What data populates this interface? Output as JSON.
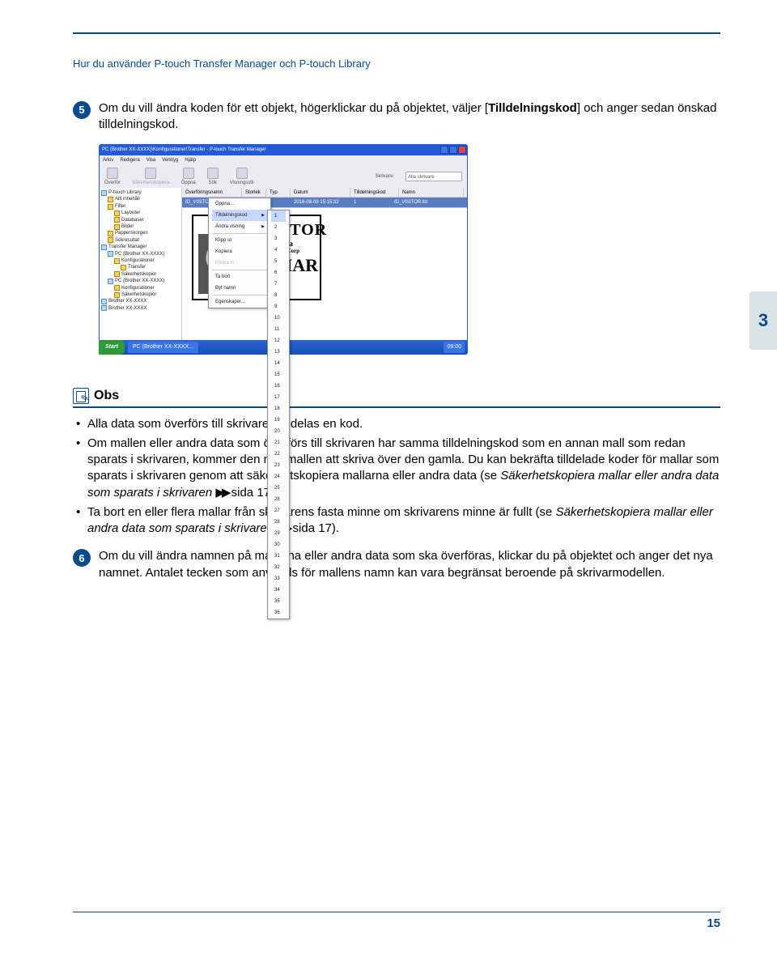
{
  "header": {
    "title": "Hur du använder P-touch Transfer Manager och P-touch Library"
  },
  "sideChapter": "3",
  "step5": {
    "num": "5",
    "text_a": "Om du vill ändra koden för ett objekt, högerklickar du på objektet, väljer [",
    "text_key": "Tilldelningskod",
    "text_b": "] och anger sedan önskad tilldelningskod."
  },
  "screenshot": {
    "title": "PC (Brother XX-XXXX)\\Konfigurationer\\Transfer - P-touch Transfer Manager",
    "menu": [
      "Arkiv",
      "Redigera",
      "Visa",
      "Verktyg",
      "Hjälp"
    ],
    "toolbar": [
      {
        "label": "Överför",
        "grey": false
      },
      {
        "label": "Säkerhetskopiera",
        "grey": true
      },
      {
        "label": "Öppna",
        "grey": false
      },
      {
        "label": "Sök",
        "grey": false
      },
      {
        "label": "Visningsstil",
        "grey": false
      }
    ],
    "printerLabel": "Skrivare:",
    "printerValue": "Alla skrivare",
    "tree": [
      {
        "label": "P-touch Library",
        "icon": "p"
      },
      {
        "label": "Allt innehåll",
        "icon": "i",
        "ind": 1
      },
      {
        "label": "Filter",
        "icon": "i",
        "ind": 1
      },
      {
        "label": "Layouter",
        "icon": "i",
        "ind": 2
      },
      {
        "label": "Databaser",
        "icon": "i",
        "ind": 2
      },
      {
        "label": "Bilder",
        "icon": "i",
        "ind": 2
      },
      {
        "label": "Papperskorgen",
        "icon": "i",
        "ind": 1
      },
      {
        "label": "Sökresultat",
        "icon": "i",
        "ind": 1
      },
      {
        "label": "Transfer Manager",
        "icon": "p"
      },
      {
        "label": "PC (Brother XX-XXXX)",
        "icon": "p",
        "ind": 1
      },
      {
        "label": "Konfigurationer",
        "icon": "i",
        "ind": 2
      },
      {
        "label": "Transfer",
        "icon": "i",
        "ind": 3
      },
      {
        "label": "Säkerhetskopior",
        "icon": "i",
        "ind": 2
      },
      {
        "label": "PC (Brother XX-XXXX)",
        "icon": "p",
        "ind": 1
      },
      {
        "label": "Konfigurationer",
        "icon": "i",
        "ind": 2
      },
      {
        "label": "Säkerhetskopior",
        "icon": "i",
        "ind": 2
      },
      {
        "label": "Brother XX-XXXX",
        "icon": "p"
      },
      {
        "label": "Brother XX-XXXX",
        "icon": "p"
      }
    ],
    "columns": [
      "Överföringsnamn",
      "Storlek",
      "Typ",
      "Datum",
      "Tilldelningskod",
      "Namn"
    ],
    "row": {
      "name": "ID_VISITOR",
      "size": "",
      "type": "",
      "date": "2016-08-09 15:15:32",
      "code": "1",
      "file": "ID_VISITOR.lbl"
    },
    "context": {
      "items": [
        {
          "label": "Öppna...",
          "grey": false
        },
        {
          "label": "Tilldelningskod",
          "grey": false,
          "sel": true,
          "sub": true
        },
        {
          "label": "Ändra visning",
          "grey": false,
          "sub": true
        },
        {
          "label": "hr"
        },
        {
          "label": "Klipp ut",
          "grey": false
        },
        {
          "label": "Kopiera",
          "grey": false
        },
        {
          "label": "Klistra in",
          "grey": true
        },
        {
          "label": "hr"
        },
        {
          "label": "Ta bort",
          "grey": false
        },
        {
          "label": "Byt namn",
          "grey": false
        },
        {
          "label": "hr"
        },
        {
          "label": "Egenskaper...",
          "grey": false
        }
      ],
      "subCount": 36,
      "subSelected": "1"
    },
    "preview": {
      "visitor": "VISITOR",
      "name": "Mr. Yoshima",
      "corp": "International Corp",
      "date": "13 MAR\n05"
    },
    "taskbar": {
      "start": "Start",
      "task": "PC (Brother XX-XXXX...",
      "clock": "09:00"
    }
  },
  "obs": {
    "title": "Obs",
    "items": [
      {
        "plain": "Alla data som överförs till skrivaren tilldelas en kod."
      },
      {
        "parts": [
          {
            "t": "Om mallen eller andra data som överförs till skrivaren har samma tilldelningskod som en annan mall som redan sparats i skrivaren, kommer den nya mallen att skriva över den gamla. Du kan bekräfta tilldelade koder för mallar som sparats i skrivaren genom att säkerhetskopiera mallarna eller andra data (se "
          },
          {
            "t": "Säkerhetskopiera mallar eller andra data som sparats i skrivaren",
            "i": true
          },
          {
            "t": " "
          },
          {
            "arrows": true
          },
          {
            "t": " sida 17)."
          }
        ]
      },
      {
        "parts": [
          {
            "t": "Ta bort en eller flera mallar från skrivarens fasta minne om skrivarens minne är fullt (se "
          },
          {
            "t": "Säkerhetskopiera mallar eller andra data som sparats i skrivaren",
            "i": true
          },
          {
            "t": " "
          },
          {
            "arrows": true
          },
          {
            "t": " sida 17)."
          }
        ]
      }
    ]
  },
  "step6": {
    "num": "6",
    "text": "Om du vill ändra namnen på mallarna eller andra data som ska överföras, klickar du på objektet och anger det nya namnet. Antalet tecken som används för mallens namn kan vara begränsat beroende på skrivarmodellen."
  },
  "pageNumber": "15"
}
